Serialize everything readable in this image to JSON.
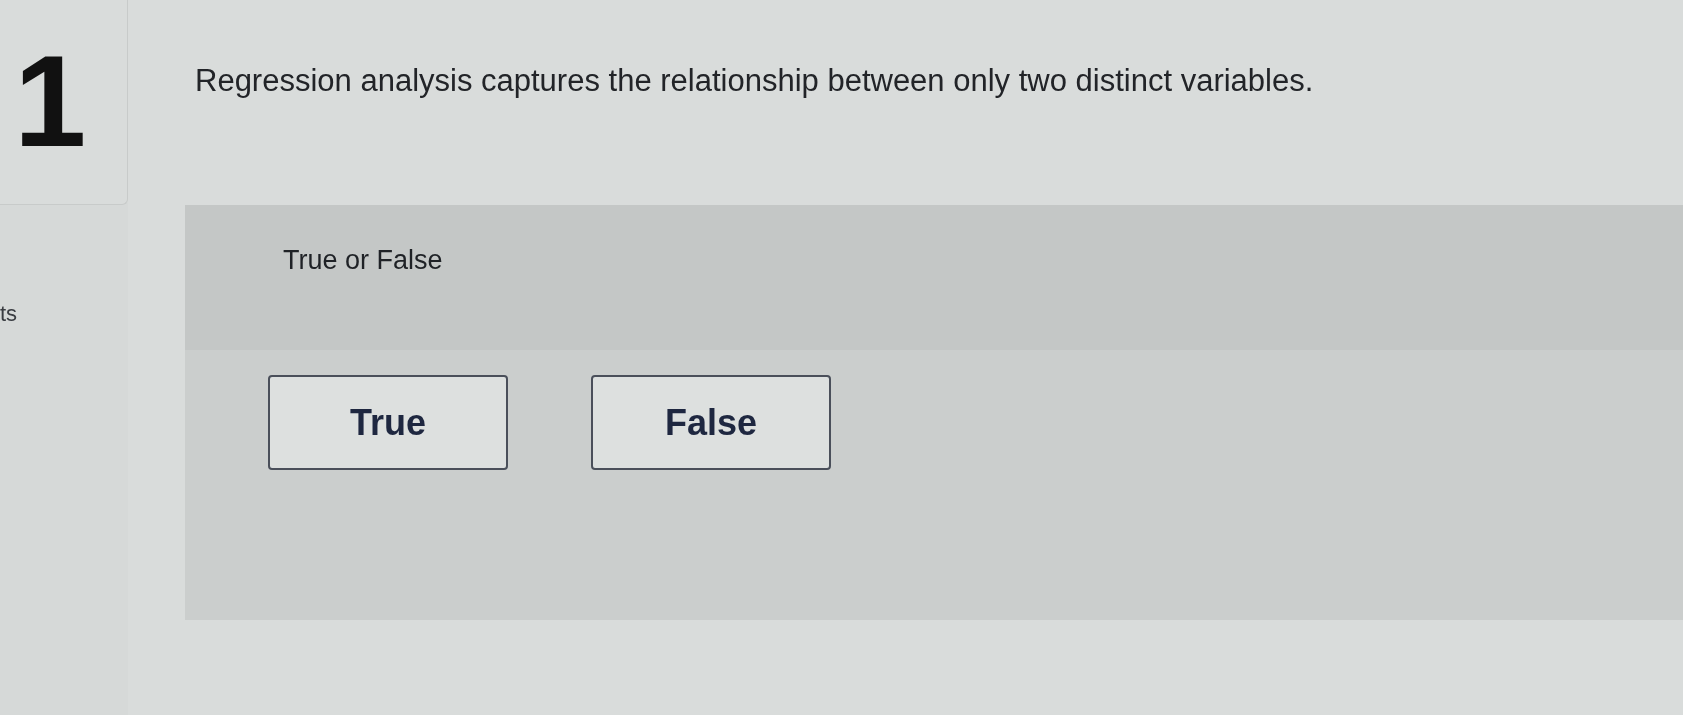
{
  "question": {
    "number": "1",
    "text": "Regression analysis captures the relationship between only two distinct variables.",
    "points_label": "ts"
  },
  "answer_panel": {
    "prompt": "True or False",
    "options": [
      {
        "label": "True",
        "selected": false
      },
      {
        "label": "False",
        "selected": false
      }
    ]
  }
}
